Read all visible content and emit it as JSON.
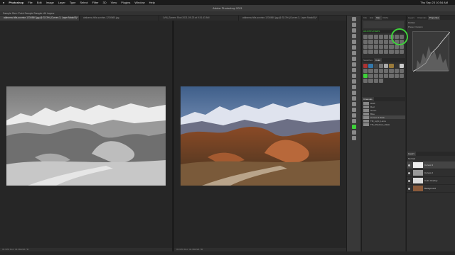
{
  "mac_menu": {
    "apple": "",
    "app_name": "Photoshop",
    "items": [
      "File",
      "Edit",
      "Image",
      "Layer",
      "Type",
      "Select",
      "Filter",
      "3D",
      "View",
      "Plugins",
      "Window",
      "Help"
    ],
    "clock": "Thu Sep 23 10:54 AM"
  },
  "window_title": "Adobe Photoshop 2021",
  "options_bar": "Sample Size:  Point Sample    Sample:  All Layers",
  "doc_tabs": [
    {
      "label": "alabama-hills-sunrise-1234560.jpg @ 33.3% (Curves 3, Layer Mask/8) *",
      "active": true
    },
    {
      "label": "alabama-hills-sunrise-1234560.jpg",
      "active": false
    },
    {
      "label": "LVM_Screen Shot 2021-09-23 at 9.51.43 AM",
      "active": false
    },
    {
      "label": "alabama-hills-sunrise-1234560.jpg @ 33.3% (Curves 3, Layer Mask/8) *",
      "active": false
    }
  ],
  "status_left": "33.33%    Doc: 34.3M/226.7M",
  "status_right": "33.33%    Doc: 34.3M/226.7M",
  "panel_a": {
    "tabs": [
      "Info",
      "Hist",
      "Nav",
      "Paths",
      "Tool Preset"
    ],
    "adjust_label": "ADJUSTLAYERS",
    "swatch_tabs": [
      "Swatches",
      "Color"
    ]
  },
  "panel_b": {
    "tabs": [
      "Layers",
      "Channels",
      "Properties"
    ],
    "properties_title": "Curves",
    "preset_label": "Preset: Custom",
    "layer_tabs": [
      "Layers"
    ],
    "blend_mode": "Normal",
    "layers": [
      {
        "name": "Curves 3",
        "selected": true
      },
      {
        "name": "Curves 2",
        "selected": false
      },
      {
        "name": "Color Overlay",
        "selected": false
      },
      {
        "name": "Background",
        "selected": false
      }
    ]
  },
  "channels": {
    "title": "Channels",
    "rows": [
      "RGB",
      "Red",
      "Green",
      "Blue",
      "Curves 3 Mask",
      "TM_Light_Luma",
      "TM_Shadows_Mask"
    ]
  },
  "colors": {
    "accent_highlight": "#3ed13a"
  }
}
